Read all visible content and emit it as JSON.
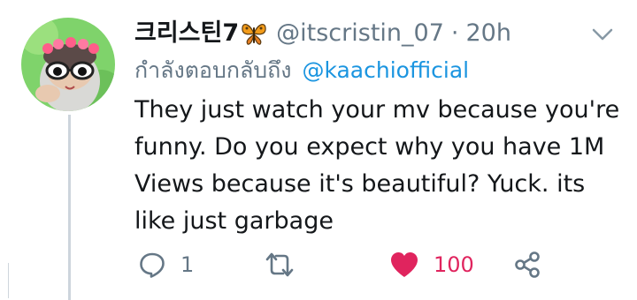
{
  "tweet": {
    "display_name": "크리스틴7",
    "name_emoji": "butterfly-icon",
    "handle": "@itscristin_07",
    "separator": "·",
    "time": "20h",
    "reply_prefix": "กำลังตอบกลับถึง",
    "reply_to": "@kaachiofficial",
    "text": "They just watch your mv because you're funny. Do you expect why you have 1M Views because it's beautiful? Yuck. its like just garbage",
    "actions": {
      "reply_count": "1",
      "retweet_count": "",
      "like_count": "100",
      "liked": true
    }
  },
  "colors": {
    "secondary_text": "#657786",
    "link": "#1b95e0",
    "like": "#e0245e",
    "thread_line": "#cdd5dc"
  }
}
